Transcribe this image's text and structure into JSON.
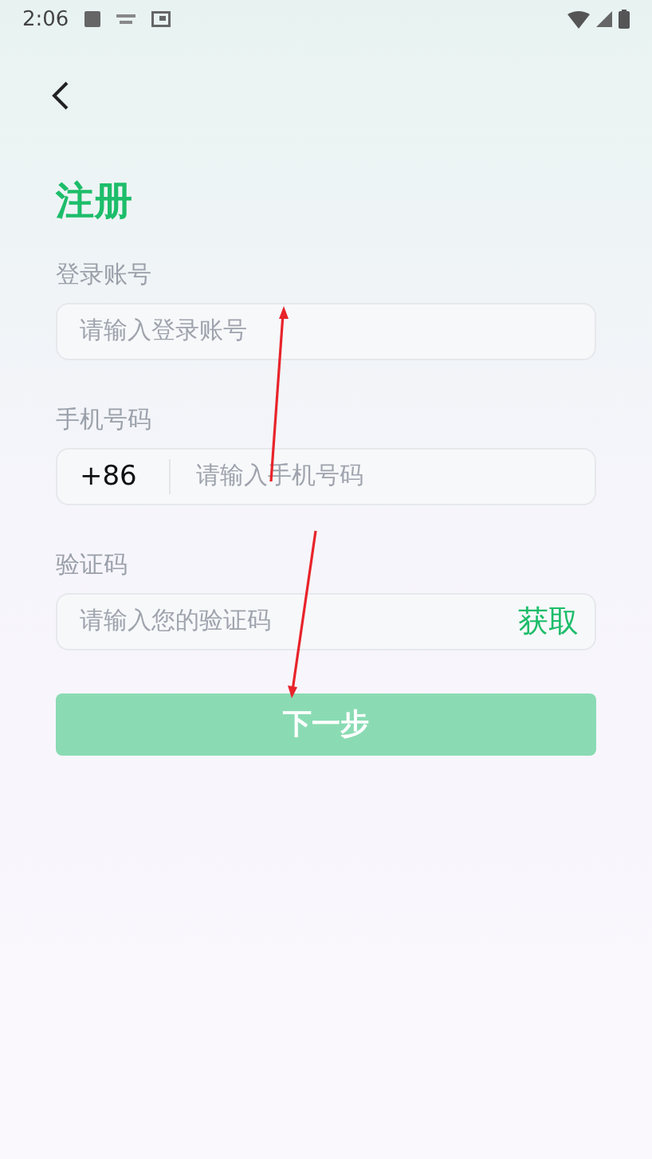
{
  "status_bar": {
    "time": "2:06"
  },
  "title": "注册",
  "fields": [
    {
      "kind": "plain",
      "label": "登录账号",
      "placeholder": "请输入登录账号"
    },
    {
      "kind": "phone",
      "label": "手机号码",
      "prefix": "+86",
      "placeholder": "请输入手机号码"
    },
    {
      "kind": "code",
      "label": "验证码",
      "placeholder": "请输入您的验证码",
      "action": "获取"
    }
  ],
  "next_button": {
    "label": "下一步",
    "disabled": true
  }
}
